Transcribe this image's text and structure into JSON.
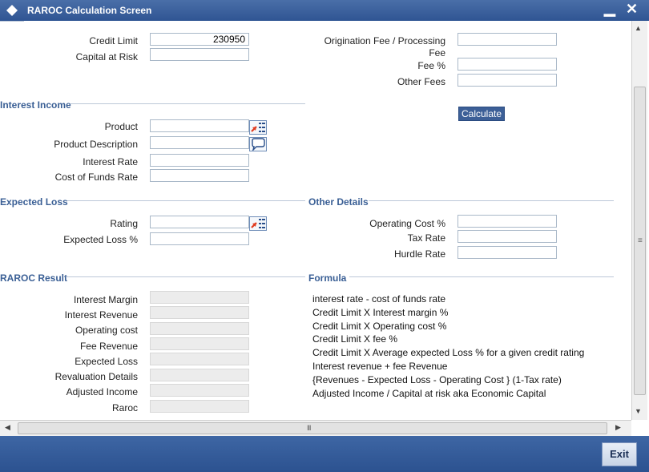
{
  "window": {
    "title": "RAROC Calculation Screen",
    "minimize_glyph": "▁",
    "close_glyph": "✕"
  },
  "top_fields": {
    "credit_limit_label": "Credit Limit",
    "credit_limit_value": "230950",
    "capital_at_risk_label": "Capital at Risk",
    "capital_at_risk_value": "",
    "origination_fee_label_line1": "Origination Fee / Processing",
    "origination_fee_label_line2": "Fee",
    "origination_fee_value": "",
    "fee_pct_label": "Fee %",
    "fee_pct_value": "",
    "other_fees_label": "Other Fees",
    "other_fees_value": ""
  },
  "interest_income": {
    "section_title": "Interest Income",
    "product_label": "Product",
    "product_value": "",
    "product_description_label": "Product Description",
    "product_description_value": "",
    "interest_rate_label": "Interest Rate",
    "interest_rate_value": "",
    "cost_of_funds_label": "Cost of Funds Rate",
    "cost_of_funds_value": ""
  },
  "calculate_button": "Calculate",
  "expected_loss": {
    "section_title": "Expected Loss",
    "rating_label": "Rating",
    "rating_value": "",
    "expected_loss_pct_label": "Expected Loss %",
    "expected_loss_pct_value": ""
  },
  "other_details": {
    "section_title": "Other Details",
    "operating_cost_label": "Operating Cost %",
    "operating_cost_value": "",
    "tax_rate_label": "Tax Rate",
    "tax_rate_value": "",
    "hurdle_rate_label": "Hurdle Rate",
    "hurdle_rate_value": ""
  },
  "raroc_result": {
    "section_title": "RAROC Result",
    "rows": [
      {
        "label": "Interest Margin",
        "value": ""
      },
      {
        "label": "Interest Revenue",
        "value": ""
      },
      {
        "label": "Operating cost",
        "value": ""
      },
      {
        "label": "Fee Revenue",
        "value": ""
      },
      {
        "label": "Expected Loss",
        "value": ""
      },
      {
        "label": "Revaluation Details",
        "value": ""
      },
      {
        "label": "Adjusted Income",
        "value": ""
      },
      {
        "label": "Raroc",
        "value": ""
      }
    ]
  },
  "formula": {
    "section_title": "Formula",
    "lines": [
      "interest rate - cost of funds rate",
      "Credit Limit X Interest margin %",
      "Credit Limit X Operating cost %",
      "Credit Limit X fee %",
      "Credit Limit X Average expected Loss % for a given credit rating",
      "Interest revenue + fee Revenue",
      "{Revenues - Expected Loss - Operating Cost } (1-Tax rate)",
      "Adjusted Income / Capital at risk aka Economic Capital"
    ]
  },
  "scrollbars": {
    "up": "▲",
    "down": "▼",
    "left": "◀",
    "right": "▶",
    "v_grip": "≡",
    "h_grip": "III"
  },
  "footer": {
    "exit_label": "Exit"
  },
  "colors": {
    "titlebar": "#2f5593",
    "section_title": "#3a5f95",
    "footer": "#2c5290"
  }
}
